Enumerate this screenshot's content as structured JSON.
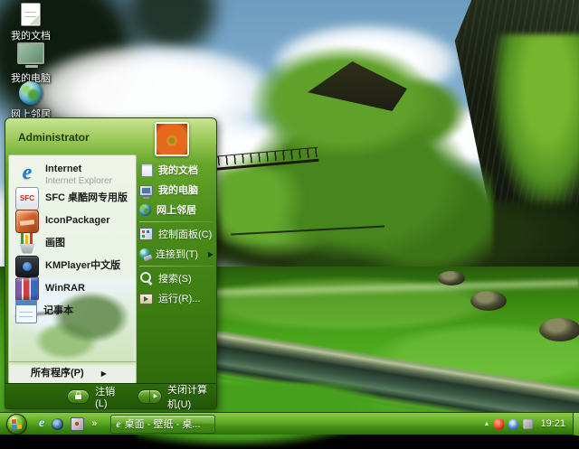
{
  "desktop": {
    "icons": [
      {
        "label": "我的文档",
        "icon": "my-documents-icon"
      },
      {
        "label": "我的电脑",
        "icon": "my-computer-icon"
      },
      {
        "label": "网上邻居",
        "icon": "network-places-icon"
      }
    ]
  },
  "icons": {
    "ie_glyph": "e",
    "sfc_glyph": "SFC"
  },
  "start_menu": {
    "user_name": "Administrator",
    "user_picture": "orange-flower-photo",
    "left_items": [
      {
        "label": "Internet",
        "sublabel": "Internet Explorer",
        "icon": "internet-explorer-icon"
      },
      {
        "label": "SFC 桌酷网专用版",
        "icon": "sfc-icon"
      },
      {
        "label": "IconPackager",
        "icon": "iconpackager-icon"
      },
      {
        "label": "画图",
        "icon": "paint-icon"
      },
      {
        "label": "KMPlayer中文版",
        "icon": "kmplayer-icon"
      },
      {
        "label": "WinRAR",
        "icon": "winrar-icon"
      },
      {
        "label": "记事本",
        "icon": "notepad-icon"
      }
    ],
    "all_programs": {
      "label": "所有程序(P)",
      "arrow": "▶"
    },
    "right_items": [
      {
        "label": "我的文档",
        "icon": "my-documents-icon"
      },
      {
        "label": "我的电脑",
        "icon": "my-computer-icon"
      },
      {
        "label": "网上邻居",
        "icon": "network-places-icon"
      },
      {
        "label": "控制面板(C)",
        "icon": "control-panel-icon"
      },
      {
        "label": "连接到(T)",
        "icon": "connect-to-icon",
        "submenu_arrow": "▶"
      },
      {
        "label": "搜索(S)",
        "icon": "search-icon"
      },
      {
        "label": "运行(R)...",
        "icon": "run-icon"
      }
    ],
    "footer": {
      "logoff_label": "注销(L)",
      "shutdown_label": "关闭计算机(U)",
      "shutdown_arrow": "▶"
    }
  },
  "taskbar": {
    "overflow_chevron": "»",
    "tasks": [
      {
        "label": "桌面 - 壁纸 - 桌...",
        "icon": "internet-explorer-icon",
        "active": true
      }
    ],
    "tray": {
      "hidden_icons_arrow": "▲",
      "icons": [
        "red-app-icon",
        "blue-app-icon",
        "volume-icon"
      ],
      "time": "19:21"
    }
  },
  "theme": {
    "menu_green": "#3c7d10",
    "taskbar_green_light": "#6fb42e",
    "taskbar_green_dark": "#2f7009",
    "text_white": "#ffffff"
  }
}
